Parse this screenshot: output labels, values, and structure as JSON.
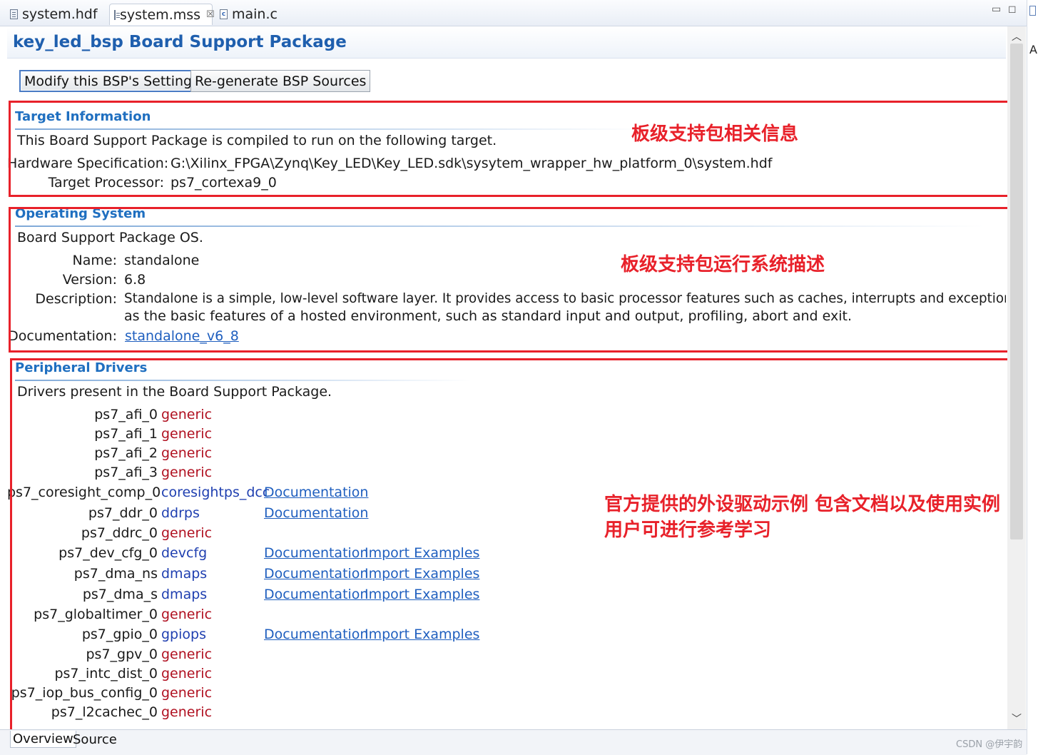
{
  "tabs": [
    {
      "label": "system.hdf",
      "icon": "file-icon"
    },
    {
      "label": "system.mss",
      "icon": "file-icon",
      "close": "☒"
    },
    {
      "label": "main.c",
      "icon": "c-file-icon"
    }
  ],
  "window_controls": {
    "minimize": "▭",
    "maximize": "◻"
  },
  "side_strip": {
    "label": "A"
  },
  "header": {
    "title": "key_led_bsp Board Support Package"
  },
  "toolbar": {
    "modify_label": "Modify this BSP's Settings",
    "regenerate_label": "Re-generate BSP Sources"
  },
  "target_info": {
    "title": "Target Information",
    "intro": "This Board Support Package is compiled to run on the following target.",
    "hw_spec_label": "Hardware Specification:",
    "hw_spec_value": "G:\\Xilinx_FPGA\\Zynq\\Key_LED\\Key_LED.sdk\\sysytem_wrapper_hw_platform_0\\system.hdf",
    "processor_label": "Target Processor:",
    "processor_value": "ps7_cortexa9_0",
    "annotation": "板级支持包相关信息"
  },
  "operating_system": {
    "title": "Operating System",
    "intro": "Board Support Package OS.",
    "name_label": "Name:",
    "name_value": "standalone",
    "version_label": "Version:",
    "version_value": "6.8",
    "description_label": "Description:",
    "description_line1": "Standalone is a simple, low-level software layer. It provides access to basic processor features such as caches, interrupts and exceptions as well",
    "description_line2": "as the basic features of a hosted environment, such as standard input and output, profiling, abort and exit.",
    "documentation_label": "Documentation:",
    "documentation_link": "standalone_v6_8",
    "annotation": "板级支持包运行系统描述"
  },
  "peripheral_drivers": {
    "title": "Peripheral Drivers",
    "intro": "Drivers present in the Board Support Package.",
    "annotation_line1": "官方提供的外设驱动示例 包含文档以及使用实例",
    "annotation_line2": "用户可进行参考学习",
    "rows": [
      {
        "name": "ps7_afi_0",
        "driver": "generic",
        "kind": "generic",
        "doc": "",
        "examples": ""
      },
      {
        "name": "ps7_afi_1",
        "driver": "generic",
        "kind": "generic",
        "doc": "",
        "examples": ""
      },
      {
        "name": "ps7_afi_2",
        "driver": "generic",
        "kind": "generic",
        "doc": "",
        "examples": ""
      },
      {
        "name": "ps7_afi_3",
        "driver": "generic",
        "kind": "generic",
        "doc": "",
        "examples": ""
      },
      {
        "name": "ps7_coresight_comp_0",
        "driver": "coresightps_dcc",
        "kind": "driver",
        "doc": "Documentation",
        "examples": ""
      },
      {
        "name": "ps7_ddr_0",
        "driver": "ddrps",
        "kind": "driver",
        "doc": "Documentation",
        "examples": ""
      },
      {
        "name": "ps7_ddrc_0",
        "driver": "generic",
        "kind": "generic",
        "doc": "",
        "examples": ""
      },
      {
        "name": "ps7_dev_cfg_0",
        "driver": "devcfg",
        "kind": "driver",
        "doc": "Documentation",
        "examples": "Import Examples"
      },
      {
        "name": "ps7_dma_ns",
        "driver": "dmaps",
        "kind": "driver",
        "doc": "Documentation",
        "examples": "Import Examples"
      },
      {
        "name": "ps7_dma_s",
        "driver": "dmaps",
        "kind": "driver",
        "doc": "Documentation",
        "examples": "Import Examples"
      },
      {
        "name": "ps7_globaltimer_0",
        "driver": "generic",
        "kind": "generic",
        "doc": "",
        "examples": ""
      },
      {
        "name": "ps7_gpio_0",
        "driver": "gpiops",
        "kind": "driver",
        "doc": "Documentation",
        "examples": "Import Examples"
      },
      {
        "name": "ps7_gpv_0",
        "driver": "generic",
        "kind": "generic",
        "doc": "",
        "examples": ""
      },
      {
        "name": "ps7_intc_dist_0",
        "driver": "generic",
        "kind": "generic",
        "doc": "",
        "examples": ""
      },
      {
        "name": "ps7_iop_bus_config_0",
        "driver": "generic",
        "kind": "generic",
        "doc": "",
        "examples": ""
      },
      {
        "name": "ps7_l2cachec_0",
        "driver": "generic",
        "kind": "generic",
        "doc": "",
        "examples": ""
      }
    ]
  },
  "scrollbar": {
    "up": "︿",
    "down": "﹀"
  },
  "bottom_tabs": [
    "Overview",
    "Source"
  ],
  "watermark": "CSDN @伊宇韵"
}
